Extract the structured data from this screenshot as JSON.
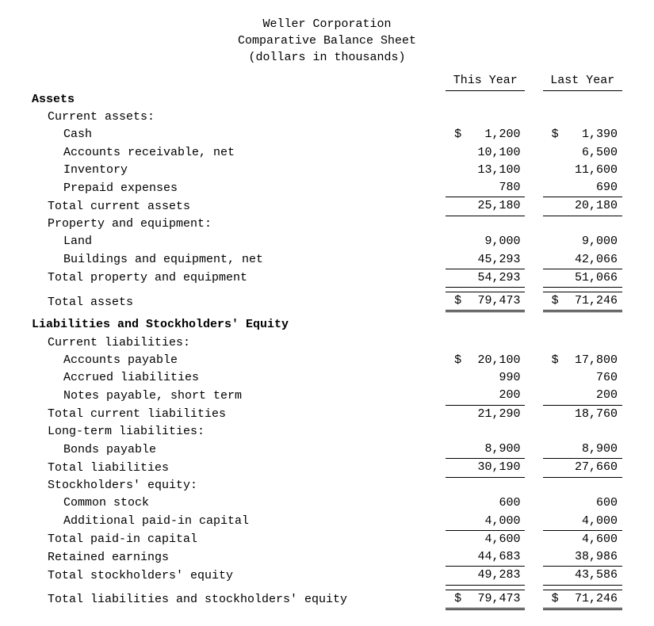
{
  "header": {
    "company": "Weller Corporation",
    "title": "Comparative Balance Sheet",
    "units": "(dollars in thousands)"
  },
  "columns": {
    "col1": "This Year",
    "col2": "Last Year"
  },
  "sections": {
    "assets_header": "Assets",
    "current_assets": {
      "title": "Current assets:",
      "cash": {
        "label": "Cash",
        "cur": "$",
        "v1": "1,200",
        "v2": "1,390"
      },
      "ar": {
        "label": "Accounts receivable, net",
        "v1": "10,100",
        "v2": "6,500"
      },
      "inventory": {
        "label": "Inventory",
        "v1": "13,100",
        "v2": "11,600"
      },
      "prepaid": {
        "label": "Prepaid expenses",
        "v1": "780",
        "v2": "690"
      },
      "total": {
        "label": "Total current assets",
        "v1": "25,180",
        "v2": "20,180"
      }
    },
    "ppe": {
      "title": "Property and equipment:",
      "land": {
        "label": "Land",
        "v1": "9,000",
        "v2": "9,000"
      },
      "bldg": {
        "label": "Buildings and equipment, net",
        "v1": "45,293",
        "v2": "42,066"
      },
      "total": {
        "label": "Total property and equipment",
        "v1": "54,293",
        "v2": "51,066"
      }
    },
    "total_assets": {
      "label": "Total assets",
      "cur": "$",
      "v1": "79,473",
      "v2": "71,246"
    },
    "liab_header": "Liabilities and Stockholders' Equity",
    "current_liab": {
      "title": "Current liabilities:",
      "ap": {
        "label": "Accounts payable",
        "cur": "$",
        "v1": "20,100",
        "v2": "17,800"
      },
      "accrued": {
        "label": "Accrued liabilities",
        "v1": "990",
        "v2": "760"
      },
      "notes": {
        "label": "Notes payable, short term",
        "v1": "200",
        "v2": "200"
      },
      "total": {
        "label": "Total current liabilities",
        "v1": "21,290",
        "v2": "18,760"
      }
    },
    "lt_liab": {
      "title": "Long-term liabilities:",
      "bonds": {
        "label": "Bonds payable",
        "v1": "8,900",
        "v2": "8,900"
      },
      "total": {
        "label": "Total liabilities",
        "v1": "30,190",
        "v2": "27,660"
      }
    },
    "equity": {
      "title": "Stockholders' equity:",
      "common": {
        "label": "Common stock",
        "v1": "600",
        "v2": "600"
      },
      "apic": {
        "label": "Additional paid-in capital",
        "v1": "4,000",
        "v2": "4,000"
      },
      "paidin": {
        "label": "Total paid-in capital",
        "v1": "4,600",
        "v2": "4,600"
      },
      "re": {
        "label": "Retained earnings",
        "v1": "44,683",
        "v2": "38,986"
      },
      "total": {
        "label": "Total stockholders' equity",
        "v1": "49,283",
        "v2": "43,586"
      }
    },
    "total_lse": {
      "label": "Total liabilities and stockholders' equity",
      "cur": "$",
      "v1": "79,473",
      "v2": "71,246"
    }
  },
  "chart_data": {
    "type": "table",
    "title": "Weller Corporation Comparative Balance Sheet (dollars in thousands)",
    "columns": [
      "Line Item",
      "This Year",
      "Last Year"
    ],
    "rows": [
      [
        "Cash",
        1200,
        1390
      ],
      [
        "Accounts receivable, net",
        10100,
        6500
      ],
      [
        "Inventory",
        13100,
        11600
      ],
      [
        "Prepaid expenses",
        780,
        690
      ],
      [
        "Total current assets",
        25180,
        20180
      ],
      [
        "Land",
        9000,
        9000
      ],
      [
        "Buildings and equipment, net",
        45293,
        42066
      ],
      [
        "Total property and equipment",
        54293,
        51066
      ],
      [
        "Total assets",
        79473,
        71246
      ],
      [
        "Accounts payable",
        20100,
        17800
      ],
      [
        "Accrued liabilities",
        990,
        760
      ],
      [
        "Notes payable, short term",
        200,
        200
      ],
      [
        "Total current liabilities",
        21290,
        18760
      ],
      [
        "Bonds payable",
        8900,
        8900
      ],
      [
        "Total liabilities",
        30190,
        27660
      ],
      [
        "Common stock",
        600,
        600
      ],
      [
        "Additional paid-in capital",
        4000,
        4000
      ],
      [
        "Total paid-in capital",
        4600,
        4600
      ],
      [
        "Retained earnings",
        44683,
        38986
      ],
      [
        "Total stockholders' equity",
        49283,
        43586
      ],
      [
        "Total liabilities and stockholders' equity",
        79473,
        71246
      ]
    ]
  }
}
